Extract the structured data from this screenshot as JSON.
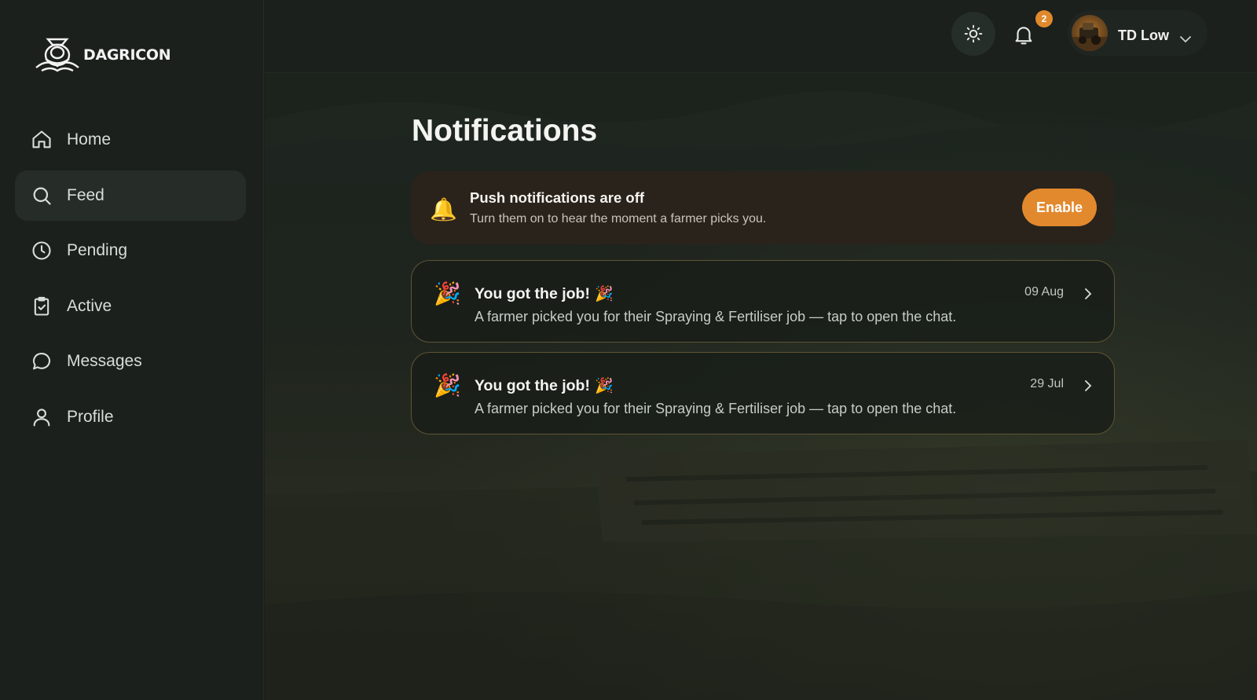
{
  "brand": {
    "name": "DAGRICON"
  },
  "sidebar": {
    "items": [
      {
        "label": "Home",
        "icon": "home-icon",
        "active": false
      },
      {
        "label": "Feed",
        "icon": "search-icon",
        "active": true
      },
      {
        "label": "Pending",
        "icon": "clock-icon",
        "active": false
      },
      {
        "label": "Active",
        "icon": "clipboard-check-icon",
        "active": false
      },
      {
        "label": "Messages",
        "icon": "chat-bubble-icon",
        "active": false
      },
      {
        "label": "Profile",
        "icon": "user-icon",
        "active": false
      }
    ]
  },
  "header": {
    "theme_icon": "sun-icon",
    "bell_icon": "bell-icon",
    "notification_count": "2",
    "user_name": "TD Low"
  },
  "page": {
    "title": "Notifications"
  },
  "push_banner": {
    "icon": "🔔",
    "title": "Push notifications are off",
    "subtitle": "Turn them on to hear the moment a farmer picks you.",
    "button_label": "Enable"
  },
  "notifications": [
    {
      "icon": "🎉",
      "title": "You got the job!",
      "title_emoji": "🎉",
      "body": "A farmer picked you for their Spraying & Fertiliser job — tap to open the chat.",
      "date": "09 Aug"
    },
    {
      "icon": "🎉",
      "title": "You got the job!",
      "title_emoji": "🎉",
      "body": "A farmer picked you for their Spraying & Fertiliser job — tap to open the chat.",
      "date": "29 Jul"
    }
  ],
  "colors": {
    "accent": "#e2892e",
    "background": "#1b201d",
    "card_border": "#5e5435"
  }
}
